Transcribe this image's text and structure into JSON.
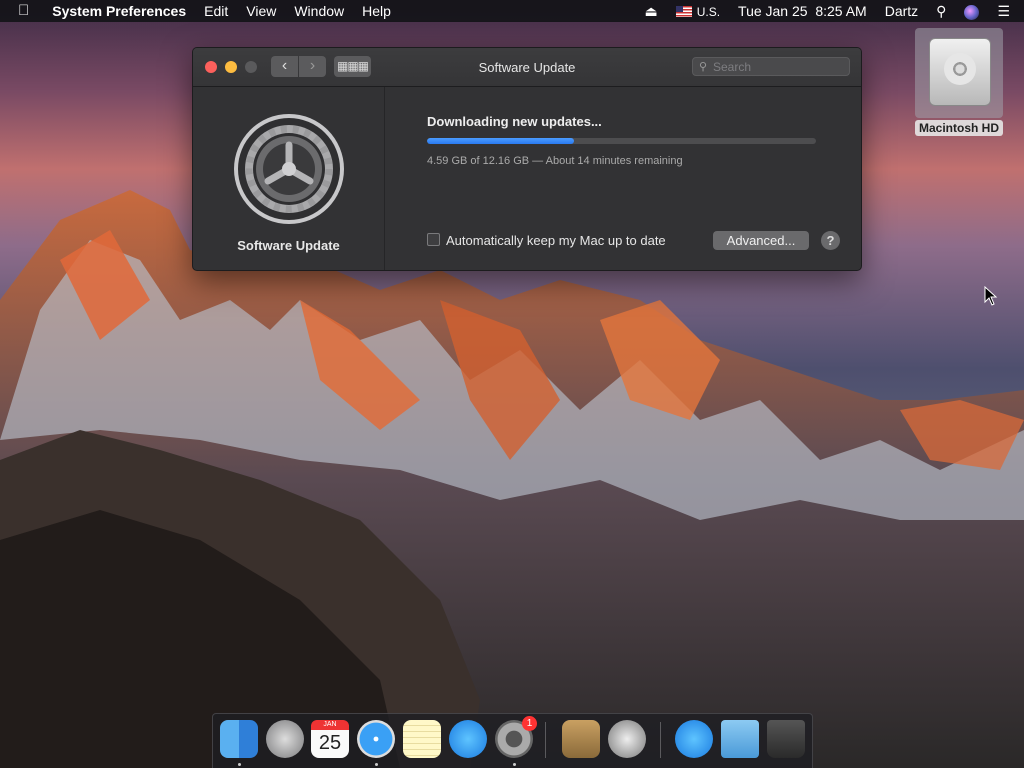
{
  "menubar": {
    "apple_icon": "apple-logo",
    "app_name": "System Preferences",
    "menus": [
      "Edit",
      "View",
      "Window",
      "Help"
    ],
    "input_source": "U.S.",
    "datetime": "Tue Jan 25  8:25 AM",
    "user": "Dartz"
  },
  "desktop": {
    "drive_label": "Macintosh HD"
  },
  "window": {
    "title": "Software Update",
    "search_placeholder": "Search",
    "sidebar_label": "Software Update",
    "download_title": "Downloading new updates...",
    "progress_fraction": 0.377,
    "status": "4.59 GB of 12.16 GB — About 14 minutes remaining",
    "auto_update_label": "Automatically keep my Mac up to date",
    "auto_update_checked": false,
    "advanced_label": "Advanced...",
    "help_label": "?"
  },
  "dock": {
    "items": [
      {
        "name": "Finder",
        "icon": "finder-icon",
        "running": true
      },
      {
        "name": "Launchpad",
        "icon": "rocket-icon",
        "running": false
      },
      {
        "name": "Calendar",
        "icon": "calendar-icon",
        "running": false,
        "month": "JAN",
        "day": "25"
      },
      {
        "name": "Safari",
        "icon": "compass-icon",
        "running": true
      },
      {
        "name": "Notes",
        "icon": "notes-icon",
        "running": false
      },
      {
        "name": "App Store",
        "icon": "app-store-icon",
        "running": false
      },
      {
        "name": "System Preferences",
        "icon": "gear-icon",
        "running": true,
        "badge": "1"
      },
      {
        "name": "Contacts",
        "icon": "contacts-icon",
        "running": false
      },
      {
        "name": "Automator",
        "icon": "robot-icon",
        "running": false
      },
      {
        "name": "Applications",
        "icon": "app-store-folder-icon",
        "running": false
      },
      {
        "name": "Downloads",
        "icon": "downloads-folder-icon",
        "running": false
      },
      {
        "name": "Trash",
        "icon": "trash-icon",
        "running": false
      }
    ]
  },
  "colors": {
    "progress_fill": "#2a7af0",
    "window_bg": "#323234",
    "close": "#fc605c",
    "minimize": "#fdbc40"
  }
}
